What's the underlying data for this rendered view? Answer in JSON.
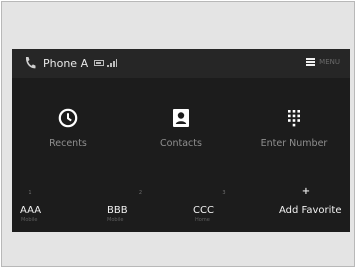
{
  "status_bar": {
    "phone_name": "Phone A",
    "menu_text": "MENU"
  },
  "main_buttons": [
    {
      "label": "Recents",
      "icon": "clock-icon"
    },
    {
      "label": "Contacts",
      "icon": "contacts-icon"
    },
    {
      "label": "Enter Number",
      "icon": "keypad-icon"
    }
  ],
  "favorites": [
    {
      "number": "1",
      "name": "AAA",
      "type": "Mobile"
    },
    {
      "number": "2",
      "name": "BBB",
      "type": "Mobile"
    },
    {
      "number": "3",
      "name": "CCC",
      "type": "Home"
    }
  ],
  "add_favorite": {
    "label": "Add Favorite",
    "icon": "plus-icon"
  },
  "colors": {
    "screen_bg": "#1c1c1c",
    "status_bar_bg": "#262626",
    "label_gray": "#8f8f8f",
    "text_white": "#f2f2f2"
  }
}
